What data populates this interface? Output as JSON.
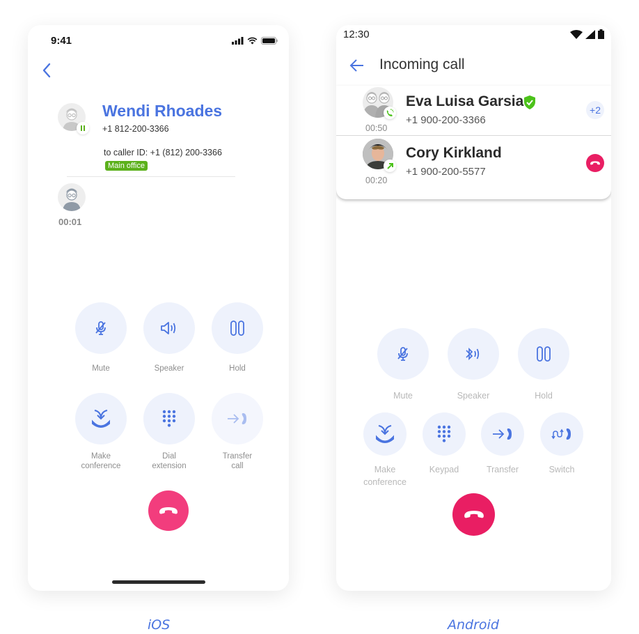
{
  "ios": {
    "status_time": "9:41",
    "contact_name": "Wendi Rhoades",
    "contact_phone": "+1 812-200-3366",
    "caller_id": "to caller ID: +1 (812) 200-3366",
    "line_tag": "Main office",
    "second_call_timer": "00:01",
    "buttons": [
      {
        "label": "Mute",
        "icon": "mic-off-icon"
      },
      {
        "label": "Speaker",
        "icon": "speaker-icon"
      },
      {
        "label": "Hold",
        "icon": "pause-icon"
      },
      {
        "label": "Make\nconference",
        "icon": "merge-icon"
      },
      {
        "label": "Dial\nextension",
        "icon": "dialpad-icon"
      },
      {
        "label": "Transfer\ncall",
        "icon": "transfer-icon"
      }
    ],
    "caption": "iOS"
  },
  "android": {
    "status_time": "12:30",
    "title": "Incoming call",
    "calls": [
      {
        "name": "Eva Luisa Garsia",
        "phone": "+1 900-200-3366",
        "timer": "00:50",
        "verified": true,
        "extra": "+2"
      },
      {
        "name": "Cory Kirkland",
        "phone": "+1 900-200-5577",
        "timer": "00:20"
      }
    ],
    "buttons": [
      {
        "label": "Mute",
        "icon": "mic-off-icon"
      },
      {
        "label": "Speaker",
        "icon": "bluetooth-audio-icon"
      },
      {
        "label": "Hold",
        "icon": "pause-icon"
      },
      {
        "label": "Make\nconference",
        "icon": "merge-icon"
      },
      {
        "label": "Keypad",
        "icon": "dialpad-icon"
      },
      {
        "label": "Transfer",
        "icon": "transfer-icon"
      },
      {
        "label": "Switch",
        "icon": "switch-call-icon"
      }
    ],
    "caption": "Android"
  },
  "colors": {
    "accent": "#4a74e0",
    "end_call_ios": "#f23d7d",
    "end_call_android": "#e91e63",
    "tag_green": "#5cb11c",
    "button_bg": "#eef2fc"
  }
}
